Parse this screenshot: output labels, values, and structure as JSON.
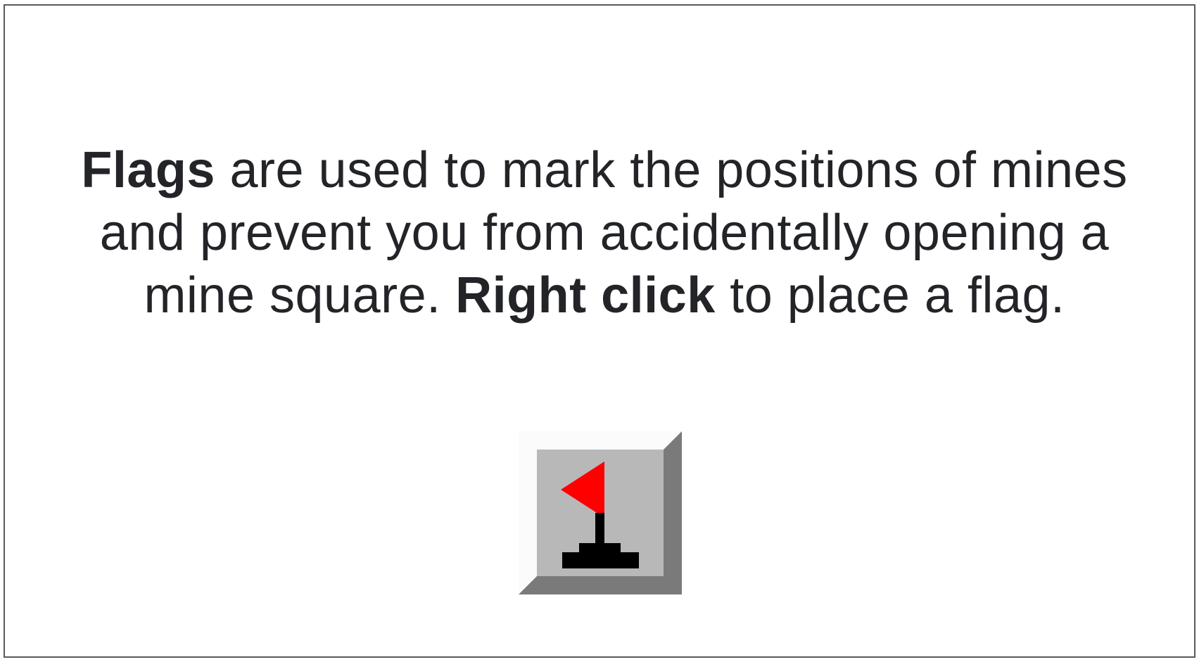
{
  "tutorial": {
    "flags_term": "Flags",
    "text_part1": " are used to mark the positions of mines and prevent you from accidentally opening a mine square. ",
    "right_click_term": "Right click",
    "text_part2": " to place a flag."
  },
  "tile": {
    "icon": "flag-icon",
    "state": "flagged",
    "colors": {
      "face": "#b8b8b8",
      "highlight": "#fbfbfb",
      "shadow": "#7a7a7a",
      "flag": "#ff0000",
      "pole": "#000000"
    }
  }
}
